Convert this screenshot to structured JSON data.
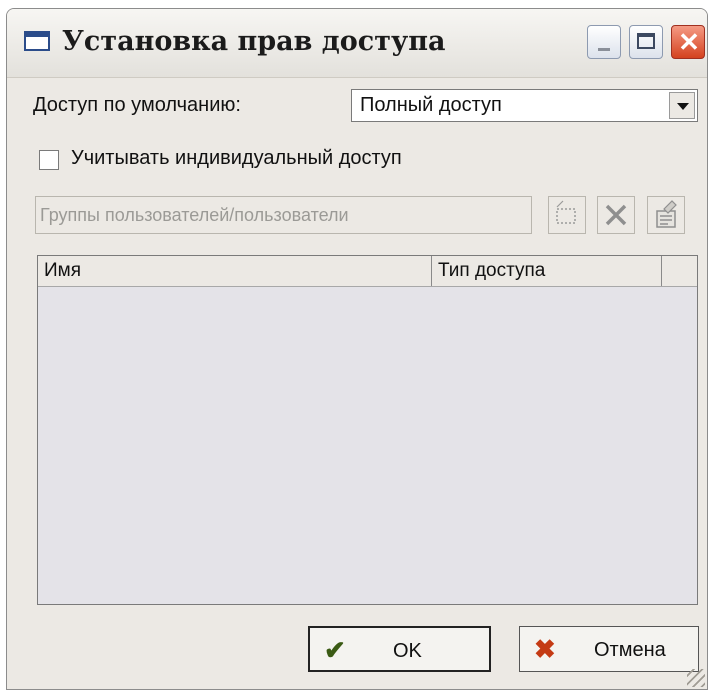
{
  "window": {
    "title": "Установка прав доступа"
  },
  "title_buttons": {
    "minimize": "minimize-icon",
    "maximize": "maximize-icon",
    "close": "✕"
  },
  "default_access": {
    "label": "Доступ по умолчанию:",
    "value": "Полный доступ"
  },
  "individual_access": {
    "label": "Учитывать индивидуальный доступ",
    "checked": false
  },
  "users": {
    "placeholder": "Группы пользователей/пользователи",
    "icons": [
      "select-users-icon",
      "delete-icon",
      "properties-icon"
    ]
  },
  "table": {
    "columns": [
      "Имя",
      "Тип доступа"
    ],
    "rows": []
  },
  "buttons": {
    "ok": "OK",
    "cancel": "Отмена"
  },
  "colors": {
    "ok_check": "#3a5a14",
    "cancel_x": "#c43a14"
  }
}
